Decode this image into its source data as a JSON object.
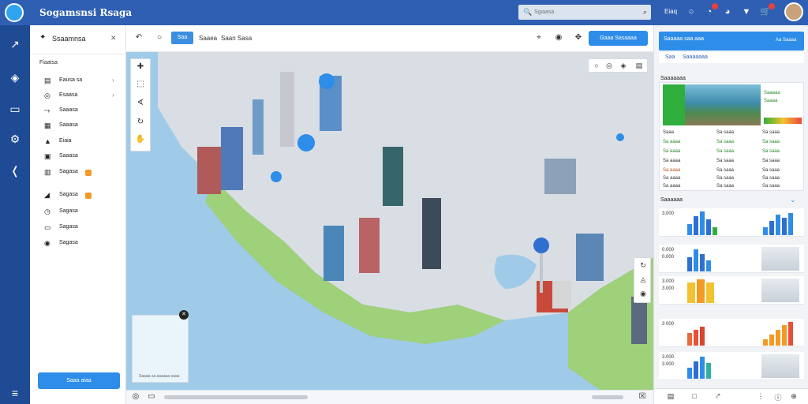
{
  "app": {
    "title": "Sogamsnsi Rsaga"
  },
  "search": {
    "placeholder": "Sgiaasa"
  },
  "topbar": {
    "label": "Eiaq",
    "notifications_count": "2"
  },
  "left_panel": {
    "title": "Ssaamnsa",
    "subtitle": "Fiaatsa",
    "items": [
      {
        "label": "Eausa sa",
        "icon": "layers-icon"
      },
      {
        "label": "Esaasa",
        "icon": "target-icon"
      },
      {
        "label": "Saaasa",
        "icon": "route-icon"
      },
      {
        "label": "Saaasa",
        "icon": "grid-icon"
      },
      {
        "label": "Eiaia",
        "icon": "user-icon"
      },
      {
        "label": "Saaasa",
        "icon": "building-icon"
      },
      {
        "label": "Sagasa",
        "icon": "table-icon"
      },
      {
        "label": "Sagasa",
        "icon": "tag-icon"
      },
      {
        "label": "Sagasa",
        "icon": "clock-icon"
      },
      {
        "label": "Sagasa",
        "icon": "chat-icon"
      },
      {
        "label": "Sagasa",
        "icon": "pin-icon"
      }
    ],
    "button_label": "Saaa aiaa"
  },
  "toolbar": {
    "pill_label": "Saa",
    "text1": "Saaea",
    "text2": "Saan Sasa",
    "action_label": "Gaaa Sasaaaa"
  },
  "map": {
    "legend_text": "Saaaa sa aaaaaa saaa"
  },
  "right_panel": {
    "header_title": "Saaaaa saa aaa",
    "header_btn": "Aa Saaaa",
    "tabs": [
      "Saa",
      "Saaaaaaa"
    ],
    "section_title": "Saaaaaaa",
    "photo_side": [
      "Saaaaa",
      "Saaaa"
    ],
    "stats": [
      [
        "Saaa",
        "Sa saaa",
        "Sa saaa"
      ],
      [
        "Sa aaaa",
        "Sa saaa",
        "Sa saaa"
      ],
      [
        "Sa aaaa",
        "Sa saaa",
        "Sa saaa"
      ],
      [
        "Sa aaaa",
        "Sa saaa",
        "Sa saaa"
      ],
      [
        "Sa aaaa",
        "Sa saaa",
        "Sa saaa"
      ],
      [
        "Sa aaaa",
        "Sa saaa",
        "Sa saaa"
      ],
      [
        "Sa aaaa",
        "Sa saaa",
        "Sa saaa"
      ]
    ],
    "section2_title": "Saaaaaa",
    "chart_rows": [
      {
        "v1": "3.000",
        "v2": ""
      },
      {
        "v1": "0.000",
        "v2": "0.000"
      },
      {
        "v1": "3.000",
        "v2": "3.000"
      },
      {
        "v1": "3 000",
        "v2": ""
      },
      {
        "v1": "3.000",
        "v2": "3.000"
      }
    ]
  },
  "colors": {
    "topbar": "#2f5fb3",
    "rail": "#1f4a94",
    "accent": "#2e8de8",
    "orange": "#f29a23"
  }
}
